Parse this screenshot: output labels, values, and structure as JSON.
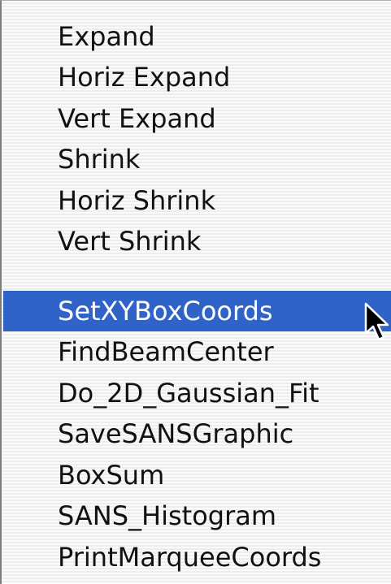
{
  "menu": {
    "items_top": [
      {
        "label": "Expand",
        "selected": false
      },
      {
        "label": "Horiz Expand",
        "selected": false
      },
      {
        "label": "Vert Expand",
        "selected": false
      },
      {
        "label": "Shrink",
        "selected": false
      },
      {
        "label": "Horiz Shrink",
        "selected": false
      },
      {
        "label": "Vert Shrink",
        "selected": false
      }
    ],
    "items_bottom": [
      {
        "label": "SetXYBoxCoords",
        "selected": true
      },
      {
        "label": "FindBeamCenter",
        "selected": false
      },
      {
        "label": "Do_2D_Gaussian_Fit",
        "selected": false
      },
      {
        "label": "SaveSANSGraphic",
        "selected": false
      },
      {
        "label": "BoxSum",
        "selected": false
      },
      {
        "label": "SANS_Histogram",
        "selected": false
      },
      {
        "label": "PrintMarqueeCoords",
        "selected": false
      }
    ]
  },
  "colors": {
    "highlight": "#2f63c7",
    "text": "#111111",
    "highlight_text": "#ffffff"
  },
  "cursor": {
    "icon": "arrow-pointer-icon"
  }
}
